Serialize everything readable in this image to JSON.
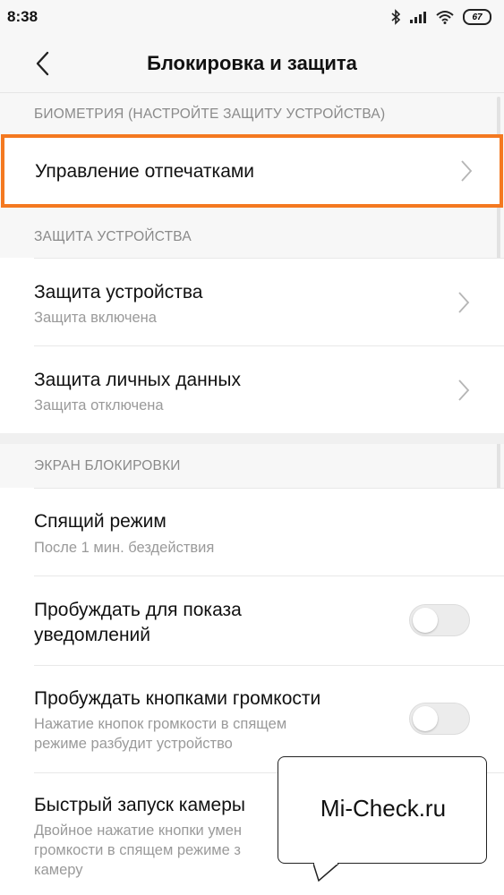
{
  "status_bar": {
    "time": "8:38",
    "battery": "67"
  },
  "header": {
    "title": "Блокировка и защита"
  },
  "biometry": {
    "section_label": "БИОМЕТРИЯ (НАСТРОЙТЕ ЗАЩИТУ УСТРОЙСТВА)",
    "fingerprints_label": "Управление отпечатками"
  },
  "device_protection": {
    "section_label": "ЗАЩИТА УСТРОЙСТВА",
    "items": [
      {
        "title": "Защита устройства",
        "subtitle": "Защита включена"
      },
      {
        "title": "Защита личных данных",
        "subtitle": "Защита отключена"
      }
    ]
  },
  "lock_screen": {
    "section_label": "ЭКРАН БЛОКИРОВКИ",
    "sleep": {
      "title": "Спящий режим",
      "subtitle": "После 1 мин. бездействия"
    },
    "wake_notifications": {
      "title_line1": "Пробуждать для показа",
      "title_line2": "уведомлений",
      "enabled": false
    },
    "wake_volume": {
      "title": "Пробуждать кнопками громкости",
      "subtitle_line1": "Нажатие кнопок громкости в спящем",
      "subtitle_line2": "режиме разбудит устройство",
      "enabled": false
    },
    "quick_camera": {
      "title": "Быстрый запуск камеры",
      "subtitle_line1": "Двойное нажатие кнопки умен",
      "subtitle_line2": "громкости в спящем режиме з",
      "subtitle_line3": "камеру"
    }
  },
  "watermark": {
    "text": "Mi-Check.ru"
  },
  "colors": {
    "highlight": "#f47920",
    "chevron": "#b5b5b5"
  }
}
